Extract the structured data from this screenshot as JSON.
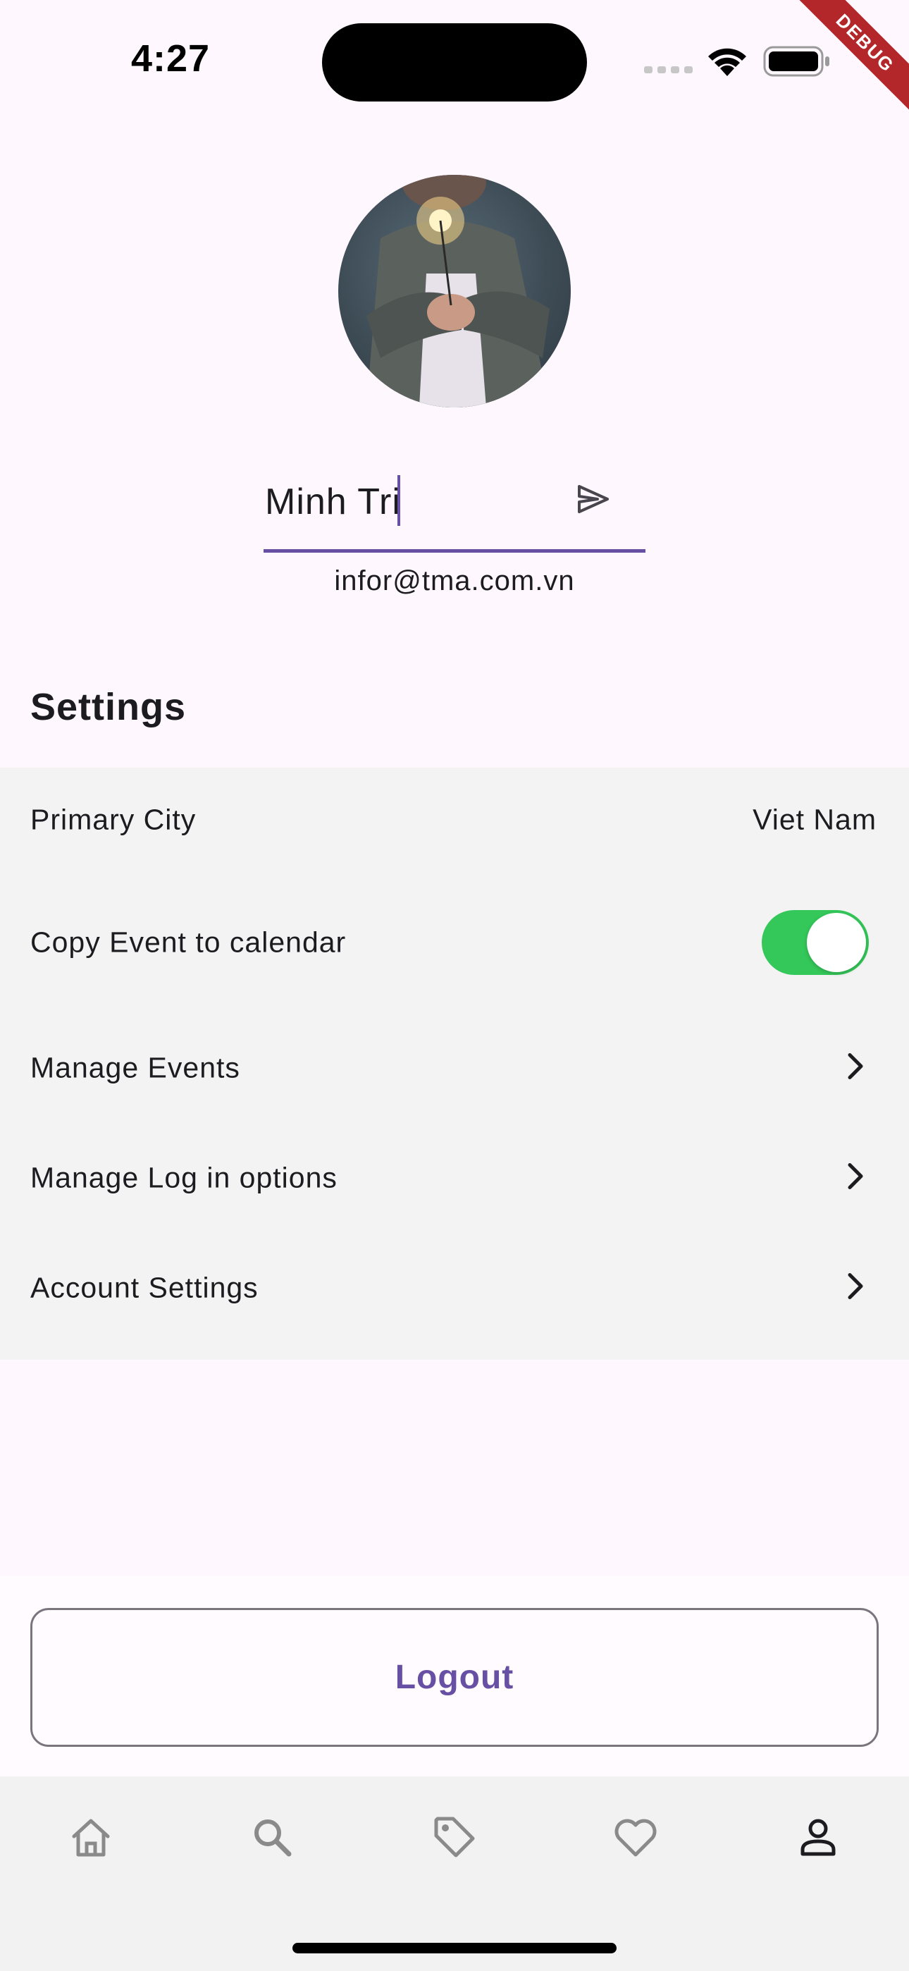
{
  "status_bar": {
    "time": "4:27",
    "debug_label": "DEBUG"
  },
  "profile": {
    "avatar_alt": "profile photo",
    "name_value": "Minh Tri",
    "email": "infor@tma.com.vn"
  },
  "settings": {
    "title": "Settings",
    "primary_city": {
      "label": "Primary City",
      "value": "Viet Nam"
    },
    "copy_event": {
      "label": "Copy Event to calendar",
      "enabled": true
    },
    "manage_events": {
      "label": "Manage Events"
    },
    "manage_login": {
      "label": "Manage Log in options"
    },
    "account_settings": {
      "label": "Account Settings"
    }
  },
  "actions": {
    "logout_label": "Logout"
  },
  "bottom_nav": {
    "items": [
      {
        "icon": "home-icon",
        "active": false
      },
      {
        "icon": "search-icon",
        "active": false
      },
      {
        "icon": "tag-icon",
        "active": false
      },
      {
        "icon": "heart-icon",
        "active": false
      },
      {
        "icon": "person-icon",
        "active": true
      }
    ]
  },
  "colors": {
    "accent": "#6750a4",
    "toggle_on": "#34c759",
    "panel_bg": "#f3f3f3",
    "page_bg": "#fef7fd",
    "debug_banner": "#b3262a"
  }
}
